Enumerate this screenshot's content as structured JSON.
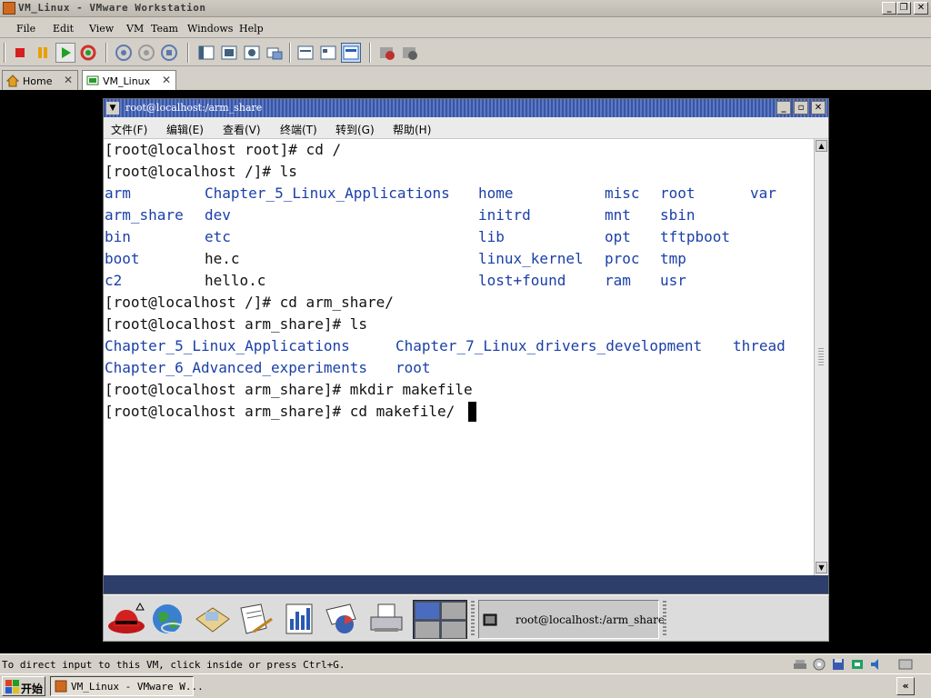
{
  "app": {
    "title": "VM_Linux - VMware Workstation",
    "window_controls": {
      "minimize": "_",
      "restore": "❐",
      "close": "✕"
    }
  },
  "menubar": {
    "items": [
      "File",
      "Edit",
      "View",
      "VM",
      "Team",
      "Windows",
      "Help"
    ]
  },
  "toolbar": {
    "buttons": [
      {
        "name": "power-off-icon",
        "color": "#d42020"
      },
      {
        "name": "suspend-icon",
        "color": "#e8a000"
      },
      {
        "name": "power-on-icon",
        "color": "#22a022"
      },
      {
        "name": "reset-icon",
        "color": "#d03030"
      },
      {
        "name": "snapshot-icon",
        "color": "#5a7ab0"
      },
      {
        "name": "revert-snapshot-icon",
        "color": "#8a8a8a"
      },
      {
        "name": "snapshot-manager-icon",
        "color": "#5a7ab0"
      },
      {
        "name": "quick-switch-icon",
        "color": "#406080"
      },
      {
        "name": "full-screen-icon",
        "color": "#406080"
      },
      {
        "name": "unity-icon",
        "color": "#406080"
      },
      {
        "name": "summary-view-icon",
        "color": "#406080"
      },
      {
        "name": "console-view-icon",
        "color": "#406080"
      },
      {
        "name": "appliance-view-icon",
        "color": "#406080"
      },
      {
        "name": "thumbnail-view-icon",
        "color": "#2060c0"
      },
      {
        "name": "record-icon",
        "color": "#c03030"
      },
      {
        "name": "replay-icon",
        "color": "#808080"
      }
    ]
  },
  "tabs": [
    {
      "label": "Home",
      "icon": "home-icon",
      "close": "✕",
      "active": false
    },
    {
      "label": "VM_Linux",
      "icon": "vm-icon",
      "close": "✕",
      "active": true
    }
  ],
  "guest_window": {
    "title": "root@localhost:/arm_share",
    "menu": [
      "文件(F)",
      "编辑(E)",
      "查看(V)",
      "终端(T)",
      "转到(G)",
      "帮助(H)"
    ],
    "menu_glyph": "▼",
    "controls": {
      "minimize": "_",
      "maximize": "▫",
      "close": "✕"
    }
  },
  "terminal": {
    "prompt_lines": [
      "[root@localhost root]# cd /",
      "[root@localhost /]# ls"
    ],
    "ls_root": [
      [
        "arm",
        "Chapter_5_Linux_Applications",
        "home",
        "misc",
        "root",
        "var"
      ],
      [
        "arm_share",
        "dev",
        "initrd",
        "mnt",
        "sbin",
        ""
      ],
      [
        "bin",
        "etc",
        "lib",
        "opt",
        "tftpboot",
        ""
      ],
      [
        "boot",
        "he.c",
        "linux_kernel",
        "proc",
        "tmp",
        ""
      ],
      [
        "c2",
        "hello.c",
        "lost+found",
        "ram",
        "usr",
        ""
      ]
    ],
    "ls_root_plain": [
      "he.c",
      "hello.c"
    ],
    "cmd_cd_arm_share": "[root@localhost /]# cd arm_share/",
    "cmd_ls_arm_share": "[root@localhost arm_share]# ls",
    "ls_arm_share": [
      [
        "Chapter_5_Linux_Applications",
        "Chapter_7_Linux_drivers_development",
        "thread"
      ],
      [
        "Chapter_6_Advanced_experiments",
        "root",
        ""
      ]
    ],
    "cmd_mkdir": "[root@localhost arm_share]# mkdir makefile",
    "cmd_current": "[root@localhost arm_share]# cd makefile/",
    "scroll_up": "▲",
    "scroll_down": "▼"
  },
  "panel": {
    "launchers": [
      "redhat-menu-icon",
      "web-browser-icon",
      "mail-icon",
      "writer-icon",
      "calc-icon",
      "presentation-icon",
      "printer-icon"
    ],
    "task_label": "root@localhost:/arm_share"
  },
  "statusbar": {
    "text": "To direct input to this VM, click inside or press Ctrl+G.",
    "devices": [
      "network-icon",
      "cdrom-icon",
      "floppy-icon",
      "usb-icon",
      "sound-icon",
      "message-icon"
    ]
  },
  "taskbar": {
    "start_label": "开始",
    "vm_task": "VM_Linux - VMware W...",
    "tray_arrow": "«"
  },
  "colors": {
    "dir_blue": "#1a3fa8",
    "terminal_text": "#111111",
    "guest_title": "#4a68b8",
    "panel_blue": "#2d3e6b"
  }
}
